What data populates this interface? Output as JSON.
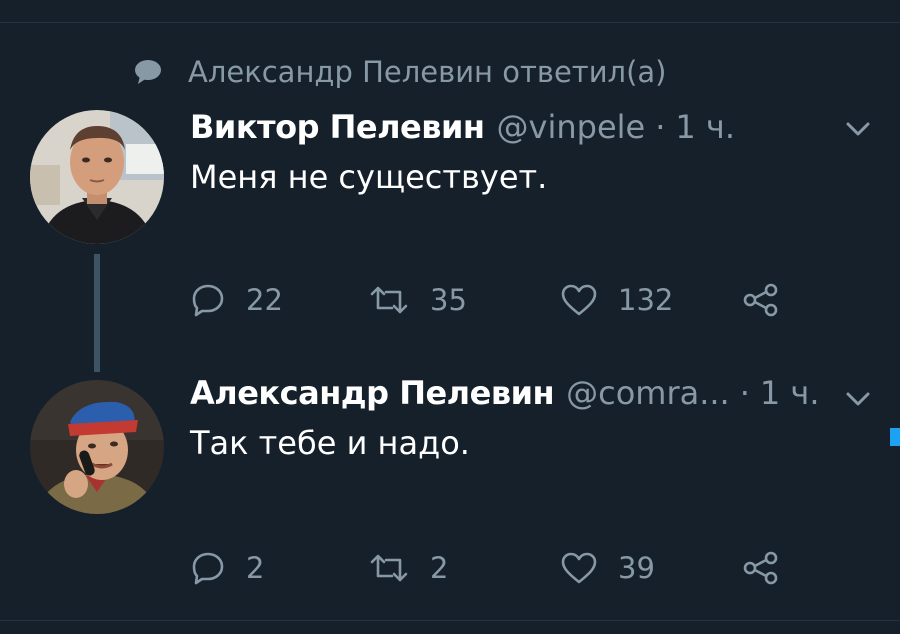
{
  "reply_context": {
    "text": "Александр Пелевин ответил(а)",
    "icon": "speech-bubble-icon"
  },
  "tweets": [
    {
      "author_name": "Виктор Пелевин",
      "handle": "@vinpele",
      "separator": "·",
      "time": "1 ч.",
      "text": "Меня не существует.",
      "avatar": "author-photo",
      "actions": {
        "replies": "22",
        "retweets": "35",
        "likes": "132"
      }
    },
    {
      "author_name": "Александр Пелевин",
      "handle": "@comra...",
      "separator": "·",
      "time": "1 ч.",
      "text": "Так тебе и надо.",
      "avatar": "author-photo",
      "actions": {
        "replies": "2",
        "retweets": "2",
        "likes": "39"
      }
    }
  ],
  "icons": {
    "reply": "reply-icon",
    "retweet": "retweet-icon",
    "like": "heart-icon",
    "share": "share-icon",
    "menu": "chevron-down-icon"
  },
  "colors": {
    "background": "#15202b",
    "secondary_text": "#8899a6",
    "divider": "#253341",
    "thread_line": "#3d5466",
    "accent": "#1da1f2"
  }
}
